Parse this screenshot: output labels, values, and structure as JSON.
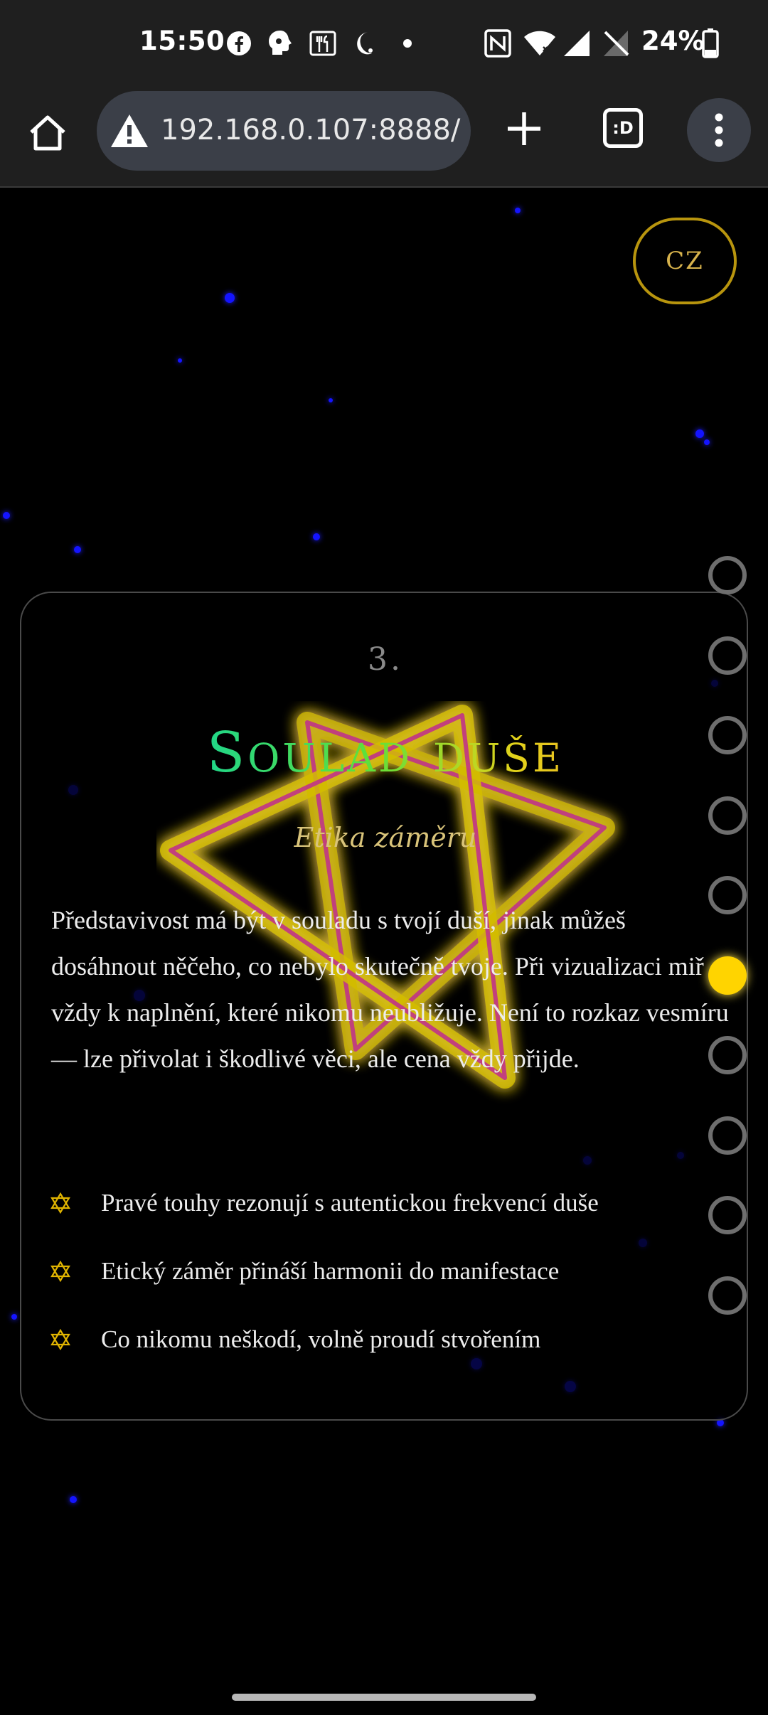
{
  "status_bar": {
    "time": "15:50",
    "battery_percent": "24%",
    "icons": [
      "facebook-icon",
      "app-notification-icon",
      "restaurant-icon",
      "night-mode-icon",
      "notification-dot-icon",
      "nfc-icon",
      "wifi-icon",
      "cell-signal-icon",
      "cell-signal-no-service-icon",
      "battery-icon"
    ]
  },
  "browser": {
    "url": "192.168.0.107:8888/",
    "security_icon": "warning-icon",
    "tab_label": ":D"
  },
  "page": {
    "language_button": "CZ",
    "card": {
      "number": "3.",
      "title": "Soulad duše",
      "subtitle": "Etika záměru",
      "body": "Představivost má být v souladu s tvojí duší, jinak můžeš dosáhnout něčeho, co nebylo skutečně tvoje. Při vizualizaci miř vždy k naplnění, které nikomu neubližuje. Není to rozkaz vesmíru — lze přivolat i škodlivé věci, ale cena vždy přijde.",
      "list": [
        "Pravé touhy rezonují s autentickou frekvencí duše",
        "Etický záměr přináší harmonii do manifestace",
        "Co nikomu neškodí, volně proudí stvořením"
      ]
    },
    "section_nav": {
      "count": 10,
      "active_index": 5
    }
  },
  "colors": {
    "accent_gold": "#ffd400",
    "lang_border": "#b8950e",
    "star_blue": "#1414ff"
  }
}
